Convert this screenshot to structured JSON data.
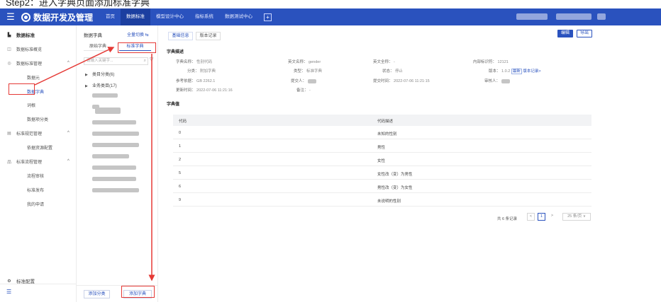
{
  "caption": "Step2：进入字典页面添加标准字典",
  "topbar": {
    "app_title": "数据开发及管理",
    "tabs": [
      "首页",
      "数据标准",
      "模型设计中心",
      "指标系统",
      "数据测试中心"
    ],
    "active_tab_index": 1,
    "plus": "+"
  },
  "leftnav": {
    "header": "数据标准",
    "items": [
      {
        "label": "数据标准概览",
        "level": 1,
        "icon": "◫"
      },
      {
        "label": "数据标准管理",
        "level": 1,
        "icon": "◎",
        "chevron": "^"
      },
      {
        "label": "数据元",
        "level": 2
      },
      {
        "label": "数据字典",
        "level": 2,
        "selected": true
      },
      {
        "label": "词根",
        "level": 2
      },
      {
        "label": "数据项分类",
        "level": 2
      },
      {
        "label": "标准规范管理",
        "level": 1,
        "icon": "▤",
        "chevron": "^"
      },
      {
        "label": "依据资源配置",
        "level": 2
      },
      {
        "label": "标准流程管理",
        "level": 1,
        "icon": "品",
        "chevron": "^"
      },
      {
        "label": "流程审核",
        "level": 2
      },
      {
        "label": "标准发布",
        "level": 2
      },
      {
        "label": "我的申请",
        "level": 2
      }
    ],
    "footer_label": "标准配置",
    "footer_icon": "☰"
  },
  "dict": {
    "title": "数据字典",
    "switch_label": "全量切换 ⇆",
    "tabs": [
      "原始字典",
      "标准字典"
    ],
    "active_tab": 1,
    "search_placeholder": "请输入关键字...",
    "tree": [
      {
        "label": "类目分类(6)"
      },
      {
        "label": "业务类目(17)"
      }
    ],
    "add_category": "添加分类",
    "add_dict": "添加字典"
  },
  "detail": {
    "tabs": [
      "基础信息",
      "版本记录"
    ],
    "buttons": {
      "edit": "编辑",
      "export": "导出"
    },
    "desc_title": "字典描述",
    "fields": {
      "cn_name_k": "字典名称：",
      "cn_name_v": "性别代码",
      "en_name_k": "英文名称：",
      "en_name_v": "gender",
      "en_full_k": "英文全称：",
      "en_full_v": "-",
      "internal_id_k": "内部标识符：",
      "internal_id_v": "12121",
      "category_k": "分类：",
      "category_v": "附加字典",
      "type_k": "类型：",
      "type_v": "标准字典",
      "status_k": "状态：",
      "status_v": "停止",
      "version_k": "版本：",
      "version_v": "1.0.2",
      "version_badge": "最新",
      "version_link": "版本记录>",
      "ref_k": "参考依据：",
      "ref_v": "GB 2262.1",
      "submitter_k": "提交人：",
      "submit_time_k": "提交时间：",
      "submit_time_v": "2022-07-06 11:21:15",
      "reviewer_k": "审核人：",
      "update_time_k": "更新时间：",
      "update_time_v": "2022-07-06 11:21:16",
      "remark_k": "备注：",
      "remark_v": "-"
    },
    "values_title": "字典值",
    "table": {
      "headers": [
        "代码",
        "代码描述"
      ],
      "rows": [
        [
          "0",
          "未知的性别"
        ],
        [
          "1",
          "男性"
        ],
        [
          "2",
          "女性"
        ],
        [
          "5",
          "女性改（变）为男性"
        ],
        [
          "6",
          "男性改（变）为女性"
        ],
        [
          "9",
          "未说明的性别"
        ]
      ]
    },
    "pagination": {
      "total": "共 6 条记录",
      "prev": "<",
      "page": "1",
      "next": ">",
      "page_size": "25 条/页 ∨"
    }
  },
  "colors": {
    "brand": "#2a52be",
    "annotation": "#e53935"
  }
}
